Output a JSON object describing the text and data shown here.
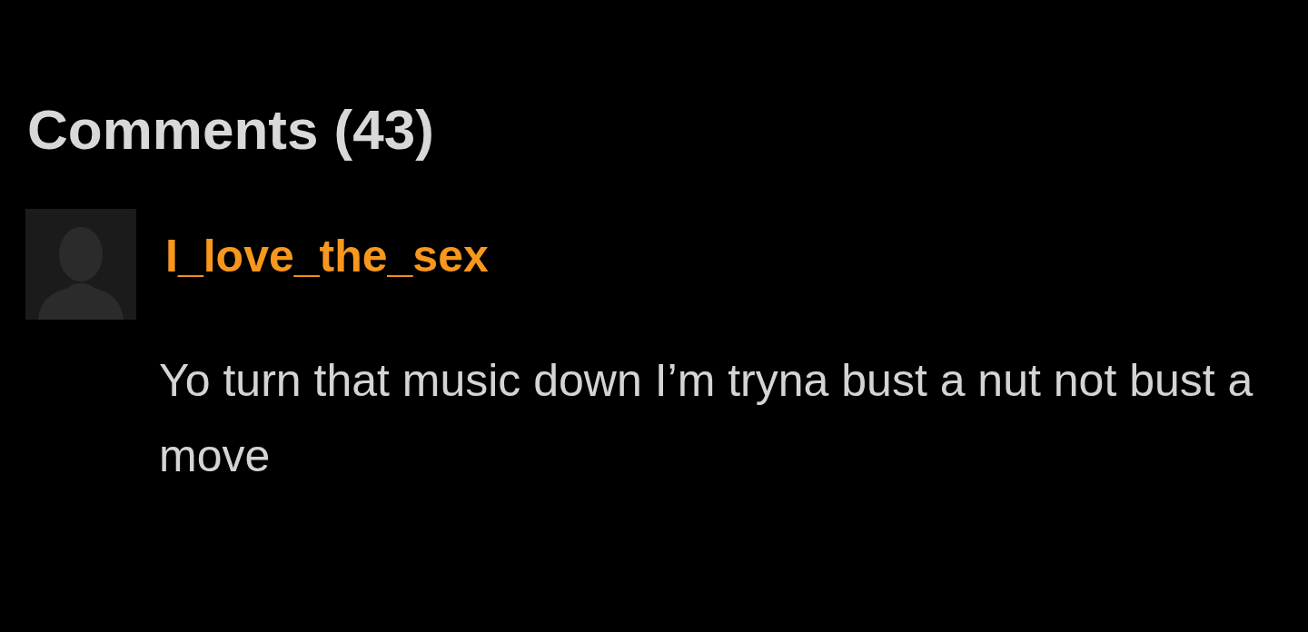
{
  "heading": "Comments (43)",
  "comments": [
    {
      "username": "I_love_the_sex",
      "text": "Yo turn that music down I’m tryna bust a nut not bust a move"
    }
  ]
}
